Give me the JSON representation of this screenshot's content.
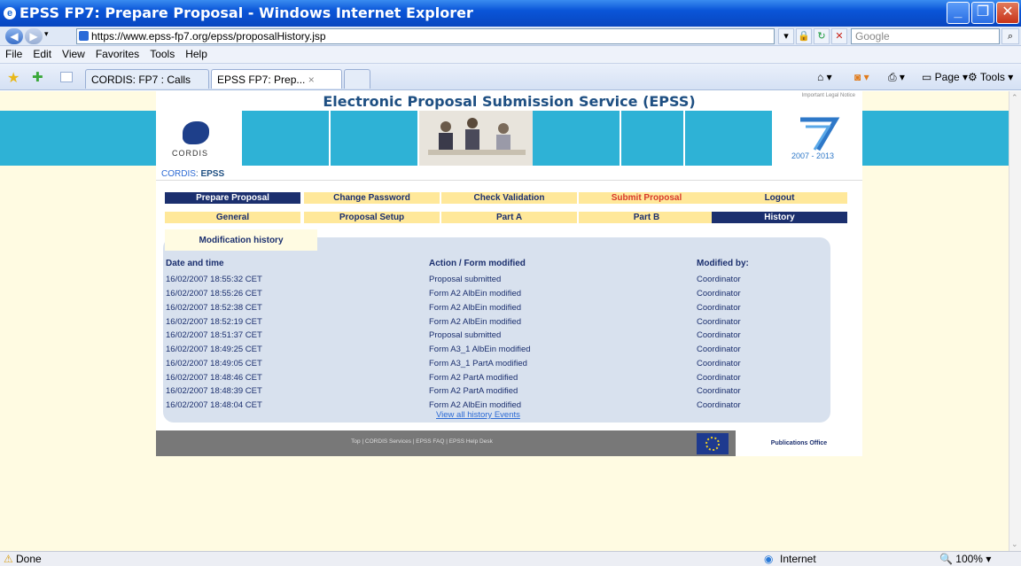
{
  "window": {
    "title": "EPSS FP7: Prepare Proposal - Windows Internet Explorer"
  },
  "address": {
    "url": "https://www.epss-fp7.org/epss/proposalHistory.jsp",
    "search_placeholder": "Google"
  },
  "menu": [
    "File",
    "Edit",
    "View",
    "Favorites",
    "Tools",
    "Help"
  ],
  "tabs": [
    {
      "label": "CORDIS: FP7 : Calls"
    },
    {
      "label": "EPSS FP7: Prep..."
    }
  ],
  "command_bar": {
    "page": "Page",
    "tools": "Tools"
  },
  "header": {
    "title": "Electronic Proposal Submission Service (EPSS)",
    "legal": "Important Legal Notice",
    "cordis": "CORDIS",
    "years": "2007 - 2013"
  },
  "breadcrumb": {
    "link": "CORDIS",
    "sep": ": ",
    "current": "EPSS"
  },
  "main_menu": [
    {
      "label": "Prepare Proposal"
    },
    {
      "label": "Change Password"
    },
    {
      "label": "Check Validation"
    },
    {
      "label": "Submit Proposal"
    },
    {
      "label": "Logout"
    }
  ],
  "sub_menu": [
    {
      "label": "General"
    },
    {
      "label": "Proposal Setup"
    },
    {
      "label": "Part A"
    },
    {
      "label": "Part B"
    },
    {
      "label": "History"
    }
  ],
  "history": {
    "tab": "Modification history",
    "headers": {
      "date": "Date and time",
      "action": "Action / Form modified",
      "by": "Modified by:"
    },
    "rows": [
      {
        "date": "16/02/2007 18:55:32 CET",
        "action": "Proposal submitted",
        "by": "Coordinator"
      },
      {
        "date": "16/02/2007 18:55:26 CET",
        "action": "Form A2 AlbEin modified",
        "by": "Coordinator"
      },
      {
        "date": "16/02/2007 18:52:38 CET",
        "action": "Form A2 AlbEin modified",
        "by": "Coordinator"
      },
      {
        "date": "16/02/2007 18:52:19 CET",
        "action": "Form A2 AlbEin modified",
        "by": "Coordinator"
      },
      {
        "date": "16/02/2007 18:51:37 CET",
        "action": "Proposal submitted",
        "by": "Coordinator"
      },
      {
        "date": "16/02/2007 18:49:25 CET",
        "action": "Form A3_1 AlbEin modified",
        "by": "Coordinator"
      },
      {
        "date": "16/02/2007 18:49:05 CET",
        "action": "Form A3_1 PartA modified",
        "by": "Coordinator"
      },
      {
        "date": "16/02/2007 18:48:46 CET",
        "action": "Form A2 PartA modified",
        "by": "Coordinator"
      },
      {
        "date": "16/02/2007 18:48:39 CET",
        "action": "Form A2 PartA modified",
        "by": "Coordinator"
      },
      {
        "date": "16/02/2007 18:48:04 CET",
        "action": "Form A2 AlbEin modified",
        "by": "Coordinator"
      }
    ],
    "view_all": "View all history Events"
  },
  "footer": {
    "links": "Top | CORDIS Services | EPSS FAQ | EPSS Help Desk",
    "publications": "Publications Office"
  },
  "status": {
    "text": "Done",
    "zone": "Internet",
    "zoom": "100%"
  }
}
